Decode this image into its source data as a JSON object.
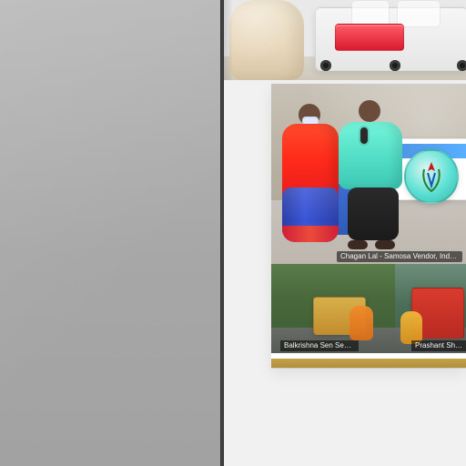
{
  "captions": {
    "main": "Chagan Lal - Samosa Vendor, Indore",
    "lower_left": "Balkrishna Sen Sen, Sharan",
    "lower_right": "Prashant Sharma"
  },
  "colors": {
    "divider": "#2a2a2a",
    "bottom_strip": "#c4a24a",
    "badge": "#5ce0d3"
  },
  "icons": {
    "badge_icon": "emblem-icon"
  }
}
